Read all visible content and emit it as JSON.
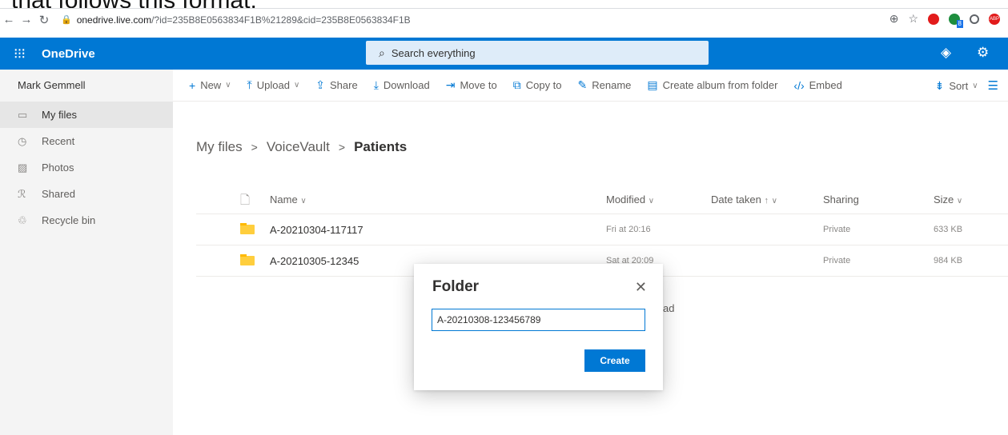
{
  "caption": "that follows this format:",
  "browser": {
    "url_host": "onedrive.live.com",
    "url_rest": "/?id=235B8E0563834F1B%21289&cid=235B8E0563834F1B",
    "badge_count": "8",
    "abp_label": "ABP"
  },
  "suite": {
    "app_name": "OneDrive",
    "search_placeholder": "Search everything"
  },
  "nav": {
    "user": "Mark Gemmell",
    "items": [
      {
        "label": "My files",
        "icon": "folder-icon",
        "selected": true
      },
      {
        "label": "Recent",
        "icon": "clock-icon"
      },
      {
        "label": "Photos",
        "icon": "photo-icon"
      },
      {
        "label": "Shared",
        "icon": "people-icon"
      },
      {
        "label": "Recycle bin",
        "icon": "trash-icon"
      }
    ]
  },
  "commands": {
    "new": "New",
    "upload": "Upload",
    "share": "Share",
    "download": "Download",
    "move": "Move to",
    "copy": "Copy to",
    "rename": "Rename",
    "album": "Create album from folder",
    "embed": "Embed",
    "sort": "Sort"
  },
  "breadcrumb": {
    "root": "My files",
    "mid": "VoiceVault",
    "current": "Patients"
  },
  "columns": {
    "name": "Name",
    "modified": "Modified",
    "date_taken": "Date taken",
    "sharing": "Sharing",
    "size": "Size"
  },
  "files": [
    {
      "name": "A-20210304-117117",
      "modified": "Fri at 20:16",
      "sharing": "Private",
      "size": "633 KB"
    },
    {
      "name": "A-20210305-12345",
      "modified": "Sat at 20:09",
      "sharing": "Private",
      "size": "984 KB"
    }
  ],
  "partial_text": "ad",
  "dialog": {
    "title": "Folder",
    "input_value": "A-20210308-123456789",
    "create_label": "Create"
  },
  "colors": {
    "brand": "#0078d4",
    "folder": "#ffce3d"
  }
}
